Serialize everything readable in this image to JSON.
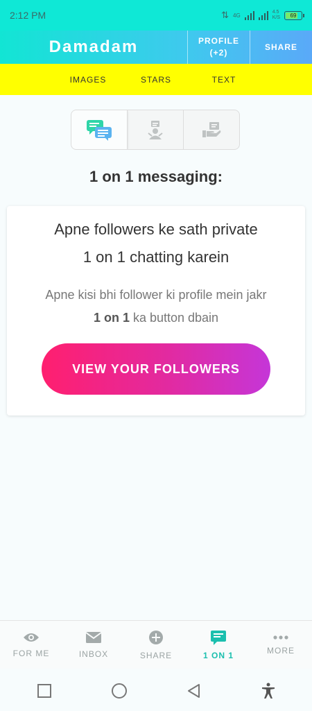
{
  "status_bar": {
    "time": "2:12 PM",
    "network": "4G",
    "speed_top": "4.5",
    "speed_bottom": "K/S",
    "battery": "69"
  },
  "header": {
    "title": "Damadam",
    "profile_label": "PROFILE",
    "profile_count": "(+2)",
    "share_label": "SHARE"
  },
  "categories": [
    "IMAGES",
    "STARS",
    "TEXT"
  ],
  "segment_icons": [
    "chat-bubbles-icon",
    "person-card-icon",
    "hand-card-icon"
  ],
  "section_title": "1 on 1 messaging:",
  "card": {
    "heading_line1": "Apne followers ke sath private",
    "heading_line2": "1 on 1 chatting karein",
    "sub_line1": "Apne kisi bhi follower ki profile mein jakr",
    "sub_bold": "1 on 1",
    "sub_rest": " ka button dbain",
    "cta_label": "VIEW YOUR FOLLOWERS"
  },
  "bottom_nav": [
    {
      "label": "FOR ME",
      "icon": "eye-icon"
    },
    {
      "label": "INBOX",
      "icon": "envelope-icon"
    },
    {
      "label": "SHARE",
      "icon": "plus-circle-icon"
    },
    {
      "label": "1 ON 1",
      "icon": "chat-icon",
      "active": true
    },
    {
      "label": "MORE",
      "icon": "dots-icon"
    }
  ],
  "colors": {
    "accent": "#1bbfae",
    "header_start": "#12e5d4",
    "strip": "#ffff00",
    "cta_start": "#ff1f6f",
    "cta_end": "#c536d8"
  }
}
